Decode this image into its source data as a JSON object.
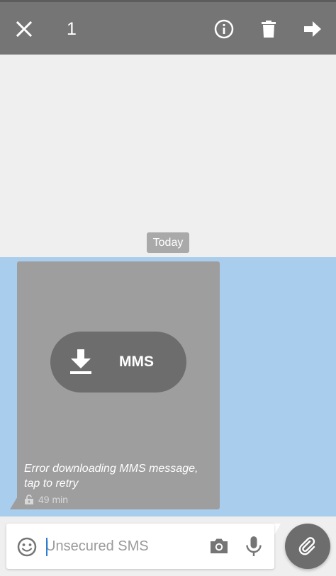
{
  "action_bar": {
    "selected_count": "1",
    "icons": {
      "close": "close-icon",
      "info": "info-icon",
      "delete": "trash-icon",
      "forward": "forward-arrow-icon"
    }
  },
  "conversation": {
    "date_label": "Today",
    "message": {
      "mms_label": "MMS",
      "download_icon": "download-icon",
      "error_text": "Error downloading MMS message, tap to retry",
      "time": "49 min",
      "status_icon": "unlocked-icon"
    }
  },
  "compose": {
    "placeholder": "Unsecured SMS",
    "value": "",
    "icons": {
      "emoji": "emoji-icon",
      "camera": "camera-icon",
      "mic": "microphone-icon",
      "attach": "paperclip-icon"
    }
  },
  "colors": {
    "action_bar": "#757575",
    "selection": "#a9cdec",
    "bubble": "#9e9e9e",
    "pill": "#6d6d6d",
    "caret": "#2a7fd4"
  }
}
